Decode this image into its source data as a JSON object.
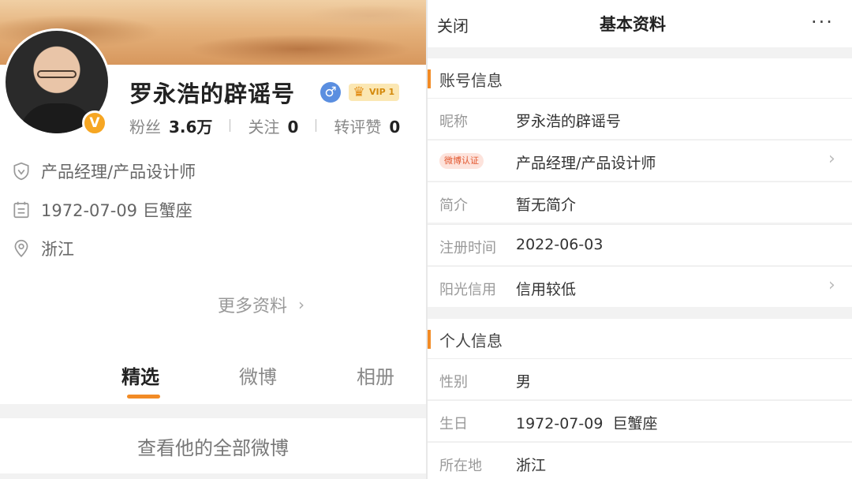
{
  "left": {
    "nickname": "罗永浩的辟谣号",
    "vip": "VIP 1",
    "gender_symbol": "♂",
    "verified_mark": "V",
    "stats": [
      {
        "label": "粉丝",
        "value": "3.6万"
      },
      {
        "label": "关注",
        "value": "0"
      },
      {
        "label": "转评赞",
        "value": "0"
      }
    ],
    "certification": "产品经理/产品设计师",
    "birthday": "1972-07-09 巨蟹座",
    "location": "浙江",
    "more_info": "更多资料",
    "tabs": [
      {
        "label": "精选",
        "active": true
      },
      {
        "label": "微博",
        "active": false
      },
      {
        "label": "相册",
        "active": false
      }
    ],
    "view_all": "查看他的全部微博",
    "icons": [
      "shield-icon",
      "calendar-icon",
      "location-pin-icon",
      "chevron-right-icon",
      "crown-icon"
    ]
  },
  "right": {
    "close": "关闭",
    "title": "基本资料",
    "more": "···",
    "account_section": "账号信息",
    "account_fields": [
      {
        "key": "昵称",
        "value": "罗永浩的辟谣号"
      },
      {
        "key": "微博认证",
        "value": "产品经理/产品设计师"
      },
      {
        "key": "简介",
        "value": "暂无简介"
      },
      {
        "key": "注册时间",
        "value": "2022-06-03"
      },
      {
        "key": "阳光信用",
        "value": "信用较低"
      }
    ],
    "personal_section": "个人信息",
    "personal_fields": [
      {
        "key": "性别",
        "value": "男"
      },
      {
        "key": "生日",
        "value": "1972-07-09  巨蟹座"
      },
      {
        "key": "所在地",
        "value": "浙江"
      }
    ]
  },
  "colors": {
    "accent": "#f28b25",
    "verified": "#f6a623",
    "gender": "#5a8ee0",
    "cert_tag_text": "#e2572e",
    "cert_tag_bg": "#fde3dc"
  }
}
